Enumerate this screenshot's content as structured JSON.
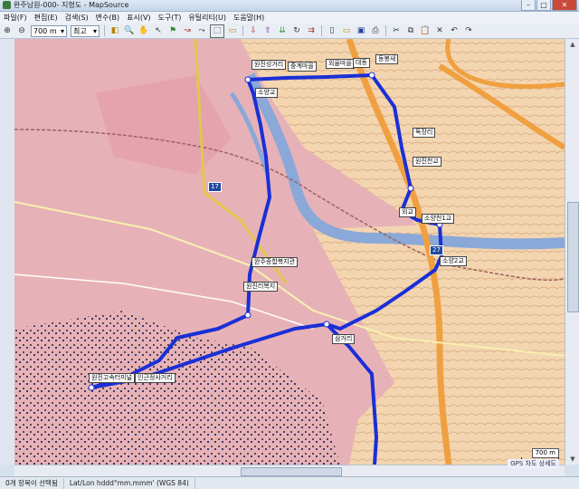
{
  "window": {
    "title": "완주남원-000- 지형도 - MapSource",
    "controls": [
      "–",
      "□",
      "✕"
    ]
  },
  "menu": [
    "파일(F)",
    "편집(E)",
    "검색(S)",
    "변수(B)",
    "표시(V)",
    "도구(T)",
    "유틸리티(U)",
    "도움말(H)"
  ],
  "toolbar": {
    "zoom_value": "700 m",
    "detail_value": "최고"
  },
  "map": {
    "labels": [
      {
        "text": "원진성거리"
      },
      {
        "text": "중계마을"
      },
      {
        "text": "외율마을"
      },
      {
        "text": "대동"
      },
      {
        "text": "동봉새"
      },
      {
        "text": "소양교"
      },
      {
        "text": "독장리"
      },
      {
        "text": "원진천교"
      },
      {
        "text": "외교"
      },
      {
        "text": "소양천1교"
      },
      {
        "text": "완주종합복지관"
      },
      {
        "text": "원진리복지"
      },
      {
        "text": "소양2교"
      },
      {
        "text": "삼거리"
      },
      {
        "text": "원진고속터미널"
      },
      {
        "text": "인근정사거리"
      }
    ],
    "route_badges": [
      "17",
      "27"
    ],
    "scale_label": "700 m",
    "device_badge": "GPS 차도 상세도"
  },
  "status": {
    "selection": "0개 항목이 선택됨",
    "coord_format": "Lat/Lon hddd°mm.mmm' (WGS 84)"
  },
  "colors": {
    "route": "#1a2fd6",
    "highway": "#f0a040",
    "river": "#8aa8d8",
    "urban": "#e7b2b7",
    "terrain": "#f3d5b0"
  }
}
